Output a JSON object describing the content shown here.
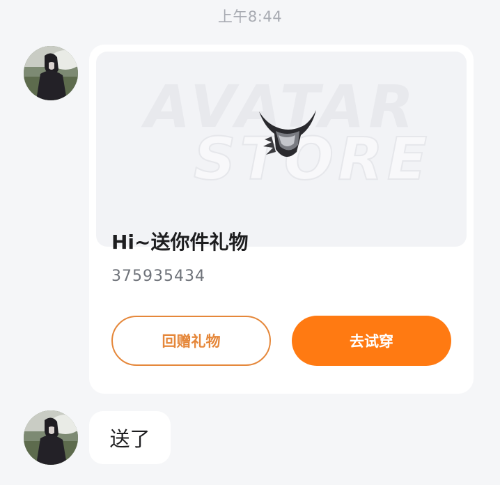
{
  "chat": {
    "timestamp": "上午8:44",
    "gift_card": {
      "banner_brand_line1": "AVATAR",
      "banner_brand_line2": "STORE",
      "banner_icon": "horned-mask-icon",
      "title": "Hi~送你件礼物",
      "code": "375935434",
      "return_gift_label": "回赠礼物",
      "try_on_label": "去试穿"
    },
    "text_message": {
      "text": "送了"
    }
  },
  "colors": {
    "background": "#f5f6f8",
    "accent_orange": "#ff7a12",
    "outline_orange": "#e5873a",
    "card": "#ffffff"
  }
}
